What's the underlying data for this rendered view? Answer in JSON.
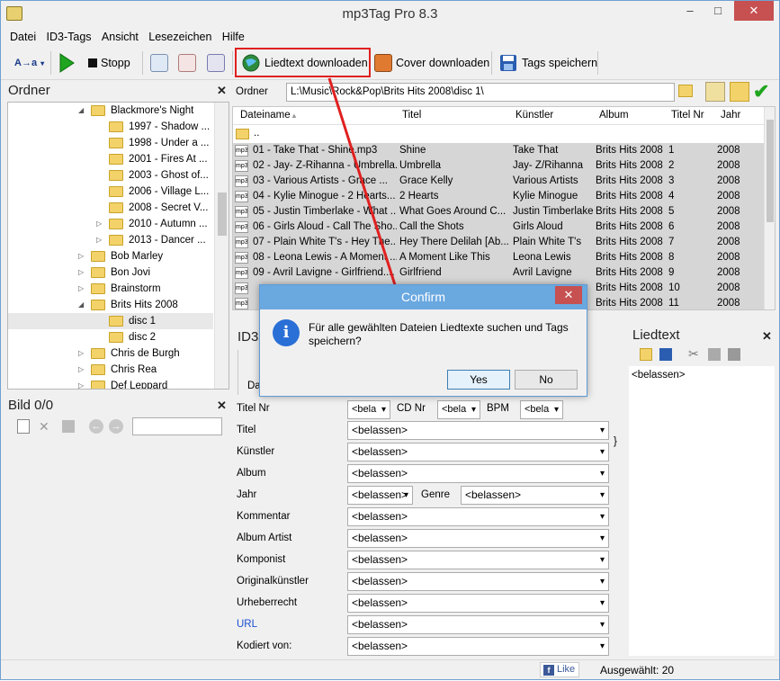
{
  "app": {
    "title": "mp3Tag Pro 8.3"
  },
  "window_controls": {
    "minimize": "–",
    "maximize": "□",
    "close": "✕"
  },
  "menu": [
    "Datei",
    "ID3-Tags",
    "Ansicht",
    "Lesezeichen",
    "Hilfe"
  ],
  "toolbar": {
    "mode_label": "A→a",
    "stop_label": "Stopp",
    "lyrics_download_label": "Liedtext downloaden",
    "cover_download_label": "Cover downloaden",
    "save_tags_label": "Tags speichern"
  },
  "folder_panel": {
    "title": "Ordner",
    "tree": [
      {
        "label": "Blackmore's Night",
        "level": 1,
        "expanded": true
      },
      {
        "label": "1997 - Shadow ...",
        "level": 2
      },
      {
        "label": "1998 - Under a ...",
        "level": 2
      },
      {
        "label": "2001 - Fires At ...",
        "level": 2
      },
      {
        "label": "2003 - Ghost of...",
        "level": 2
      },
      {
        "label": "2006 - Village L...",
        "level": 2
      },
      {
        "label": "2008 - Secret V...",
        "level": 2
      },
      {
        "label": "2010 - Autumn ...",
        "level": 2,
        "expandable": true
      },
      {
        "label": "2013 -  Dancer ...",
        "level": 2,
        "expandable": true
      },
      {
        "label": "Bob Marley",
        "level": 1,
        "expandable": true
      },
      {
        "label": "Bon Jovi",
        "level": 1,
        "expandable": true
      },
      {
        "label": "Brainstorm",
        "level": 1,
        "expandable": true
      },
      {
        "label": "Brits Hits 2008",
        "level": 1,
        "expanded": true
      },
      {
        "label": "disc 1",
        "level": 2,
        "selected": true
      },
      {
        "label": "disc 2",
        "level": 2
      },
      {
        "label": "Chris de Burgh",
        "level": 1,
        "expandable": true
      },
      {
        "label": "Chris Rea",
        "level": 1,
        "expandable": true
      },
      {
        "label": "Def Leppard",
        "level": 1,
        "expandable": true
      }
    ]
  },
  "image_panel": {
    "title": "Bild 0/0"
  },
  "path_bar": {
    "label": "Ordner",
    "value": "L:\\Music\\Rock&Pop\\Brits Hits 2008\\disc 1\\"
  },
  "file_list": {
    "columns": [
      "Dateiname",
      "Titel",
      "Künstler",
      "Album",
      "Titel Nr",
      "Jahr"
    ],
    "parent_entry": "..",
    "rows": [
      {
        "file": "01 - Take That - Shine.mp3",
        "title": "Shine",
        "artist": "Take That",
        "album": "Brits Hits 2008",
        "track": "1",
        "year": "2008"
      },
      {
        "file": "02 - Jay- Z-Rihanna - Umbrella....",
        "title": "Umbrella",
        "artist": "Jay- Z/Rihanna",
        "album": "Brits Hits 2008",
        "track": "2",
        "year": "2008"
      },
      {
        "file": "03 - Various Artists - Grace ...",
        "title": "Grace Kelly",
        "artist": "Various Artists",
        "album": "Brits Hits 2008",
        "track": "3",
        "year": "2008"
      },
      {
        "file": "04 - Kylie Minogue - 2 Hearts...",
        "title": "2 Hearts",
        "artist": "Kylie Minogue",
        "album": "Brits Hits 2008",
        "track": "4",
        "year": "2008"
      },
      {
        "file": "05 - Justin Timberlake - What ...",
        "title": "What Goes Around C...",
        "artist": "Justin Timberlake",
        "album": "Brits Hits 2008",
        "track": "5",
        "year": "2008"
      },
      {
        "file": "06 - Girls Aloud - Call The Sho...",
        "title": "Call the Shots",
        "artist": "Girls Aloud",
        "album": "Brits Hits 2008",
        "track": "6",
        "year": "2008"
      },
      {
        "file": "07 - Plain White T's - Hey The...",
        "title": "Hey There Delilah [Ab...",
        "artist": "Plain White T's",
        "album": "Brits Hits 2008",
        "track": "7",
        "year": "2008"
      },
      {
        "file": "08 - Leona Lewis - A Moment ...",
        "title": "A Moment Like This",
        "artist": "Leona Lewis",
        "album": "Brits Hits 2008",
        "track": "8",
        "year": "2008"
      },
      {
        "file": "09 - Avril Lavigne - Girlfriend....",
        "title": "Girlfriend",
        "artist": "Avril Lavigne",
        "album": "Brits Hits 2008",
        "track": "9",
        "year": "2008"
      },
      {
        "file": "",
        "title": "",
        "artist": "",
        "album": "Brits Hits 2008",
        "track": "10",
        "year": "2008"
      },
      {
        "file": "",
        "title": "",
        "artist": "",
        "album": "Brits Hits 2008",
        "track": "11",
        "year": "2008"
      }
    ]
  },
  "tag_panel": {
    "title": "ID3",
    "tab_partial": "Da",
    "keep_value": "<belassen>",
    "keep_short": "<bela",
    "labels": {
      "track_no": "Titel Nr",
      "cd_no": "CD Nr",
      "bpm": "BPM",
      "title": "Titel",
      "artist": "Künstler",
      "album": "Album",
      "year": "Jahr",
      "genre": "Genre",
      "comment": "Kommentar",
      "album_artist": "Album Artist",
      "composer": "Komponist",
      "original_artist": "Originalkünstler",
      "copyright": "Urheberrecht",
      "url": "URL",
      "encoded_by": "Kodiert von:"
    },
    "closing_brace": "}"
  },
  "lyrics_panel": {
    "title": "Liedtext",
    "content": "<belassen>"
  },
  "dialog": {
    "title": "Confirm",
    "message": "Für alle gewählten Dateien Liedtexte suchen und Tags speichern?",
    "yes": "Yes",
    "no": "No",
    "icon_letter": "i"
  },
  "status_bar": {
    "like_label": "Like",
    "selected_label": "Ausgewählt: 20"
  },
  "colors": {
    "highlight": "#e02020",
    "accent": "#6aa8e0",
    "selection": "#d6d6d6"
  }
}
